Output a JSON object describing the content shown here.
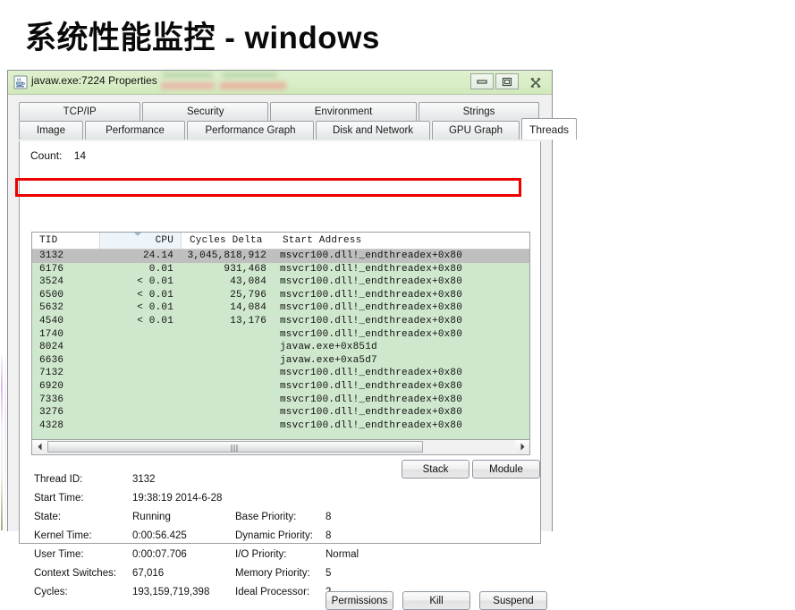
{
  "slide": {
    "title": "系统性能监控 - windows"
  },
  "window": {
    "title": "javaw.exe:7224 Properties",
    "icon": "java-coffee-cup-icon",
    "controls": {
      "minimize": "minimize-icon",
      "maximize": "maximize-icon",
      "close": "close-icon"
    }
  },
  "tabs": {
    "row1": [
      {
        "label": "TCP/IP",
        "active": false
      },
      {
        "label": "Security",
        "active": false
      },
      {
        "label": "Environment",
        "active": false
      },
      {
        "label": "Strings",
        "active": false
      }
    ],
    "row2": [
      {
        "label": "Image",
        "active": false
      },
      {
        "label": "Performance",
        "active": false
      },
      {
        "label": "Performance Graph",
        "active": false
      },
      {
        "label": "Disk and Network",
        "active": false
      },
      {
        "label": "GPU Graph",
        "active": false
      },
      {
        "label": "Threads",
        "active": true
      }
    ]
  },
  "threads_tab": {
    "count_label": "Count:",
    "count_value": "14",
    "columns": [
      "TID",
      "CPU",
      "Cycles Delta",
      "Start Address"
    ],
    "sort_column": "CPU",
    "rows": [
      {
        "tid": "3132",
        "cpu": "24.14",
        "cycles_delta": "3,045,818,912",
        "start_address": "msvcr100.dll!_endthreadex+0x80",
        "selected": true
      },
      {
        "tid": "6176",
        "cpu": "0.01",
        "cycles_delta": "931,468",
        "start_address": "msvcr100.dll!_endthreadex+0x80",
        "selected": false
      },
      {
        "tid": "3524",
        "cpu": "< 0.01",
        "cycles_delta": "43,084",
        "start_address": "msvcr100.dll!_endthreadex+0x80",
        "selected": false
      },
      {
        "tid": "6500",
        "cpu": "< 0.01",
        "cycles_delta": "25,796",
        "start_address": "msvcr100.dll!_endthreadex+0x80",
        "selected": false
      },
      {
        "tid": "5632",
        "cpu": "< 0.01",
        "cycles_delta": "14,084",
        "start_address": "msvcr100.dll!_endthreadex+0x80",
        "selected": false
      },
      {
        "tid": "4540",
        "cpu": "< 0.01",
        "cycles_delta": "13,176",
        "start_address": "msvcr100.dll!_endthreadex+0x80",
        "selected": false
      },
      {
        "tid": "1740",
        "cpu": "",
        "cycles_delta": "",
        "start_address": "msvcr100.dll!_endthreadex+0x80",
        "selected": false
      },
      {
        "tid": "8024",
        "cpu": "",
        "cycles_delta": "",
        "start_address": "javaw.exe+0x851d",
        "selected": false
      },
      {
        "tid": "6636",
        "cpu": "",
        "cycles_delta": "",
        "start_address": "javaw.exe+0xa5d7",
        "selected": false
      },
      {
        "tid": "7132",
        "cpu": "",
        "cycles_delta": "",
        "start_address": "msvcr100.dll!_endthreadex+0x80",
        "selected": false
      },
      {
        "tid": "6920",
        "cpu": "",
        "cycles_delta": "",
        "start_address": "msvcr100.dll!_endthreadex+0x80",
        "selected": false
      },
      {
        "tid": "7336",
        "cpu": "",
        "cycles_delta": "",
        "start_address": "msvcr100.dll!_endthreadex+0x80",
        "selected": false
      },
      {
        "tid": "3276",
        "cpu": "",
        "cycles_delta": "",
        "start_address": "msvcr100.dll!_endthreadex+0x80",
        "selected": false
      },
      {
        "tid": "4328",
        "cpu": "",
        "cycles_delta": "",
        "start_address": "msvcr100.dll!_endthreadex+0x80",
        "selected": false
      }
    ],
    "list_buttons": {
      "stack": "Stack",
      "module": "Module"
    },
    "details_left": [
      {
        "label": "Thread ID:",
        "value": "3132"
      },
      {
        "label": "Start Time:",
        "value": "19:38:19  2014-6-28"
      },
      {
        "label": "State:",
        "value": "Running"
      },
      {
        "label": "Kernel Time:",
        "value": "0:00:56.425"
      },
      {
        "label": "User Time:",
        "value": "0:00:07.706"
      },
      {
        "label": "Context Switches:",
        "value": "67,016"
      },
      {
        "label": "Cycles:",
        "value": "193,159,719,398"
      }
    ],
    "details_right": [
      {
        "label": "",
        "value": ""
      },
      {
        "label": "",
        "value": ""
      },
      {
        "label": "Base Priority:",
        "value": "8"
      },
      {
        "label": "Dynamic Priority:",
        "value": "8"
      },
      {
        "label": "I/O Priority:",
        "value": "Normal"
      },
      {
        "label": "Memory Priority:",
        "value": "5"
      },
      {
        "label": "Ideal Processor:",
        "value": "2"
      }
    ],
    "bottom_buttons": [
      {
        "label": "Permissions"
      },
      {
        "label": "Kill"
      },
      {
        "label": "Suspend"
      }
    ]
  },
  "annotation": {
    "highlight_color": "#ee0000",
    "highlight_target": "3132"
  },
  "colors": {
    "titlebar": "#d9edc6",
    "list_background": "#cfe8cd",
    "selected_row": "#bfbfbf",
    "accent_red": "#ee0000"
  }
}
